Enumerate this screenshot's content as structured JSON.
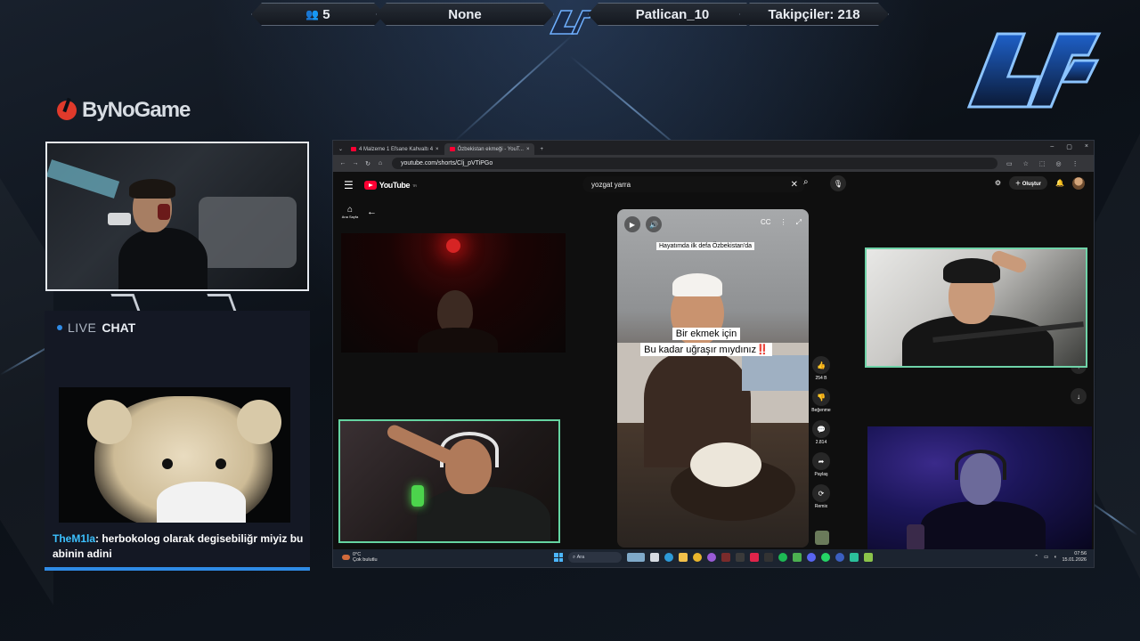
{
  "hud": {
    "viewers": "5",
    "game": "None",
    "last_follower": "Patlican_10",
    "followers": "Takipçiler: 218"
  },
  "brand": {
    "sponsor": "ByNoGame"
  },
  "chat": {
    "live_label": "LIVE",
    "chat_label": "CHAT",
    "message_user": "TheM1la",
    "message_text": ": herbokolog olarak degisebiliğr miyiz bu abinin adini"
  },
  "browser": {
    "tabs": [
      {
        "label": "4 Malzeme 1 Efsane Kahvaltı 4",
        "close": "×"
      },
      {
        "label": "Özbekistan ekmeği - YouT...",
        "close": "×"
      }
    ],
    "new_tab": "+",
    "url": "youtube.com/shorts/Clj_pVTiPGo",
    "window_controls": [
      "–",
      "▢",
      "×"
    ]
  },
  "youtube": {
    "logo_text": "YouTube",
    "logo_sup": "TR",
    "search_value": "yozgat yarra",
    "create_label": "Oluştur",
    "home_label": "Ana Sayfa",
    "short": {
      "caption_top": "Hayatımda ilk defa Özbekistan'da",
      "caption_line1": "Bir ekmek için",
      "caption_line2": "Bu kadar uğraşır mıydınız‼️"
    },
    "actions": [
      {
        "icon": "like-icon",
        "glyph": "👍",
        "label": "254 B"
      },
      {
        "icon": "dislike-icon",
        "glyph": "👎",
        "label": "Beğenme"
      },
      {
        "icon": "comment-icon",
        "glyph": "💬",
        "label": "2.814"
      },
      {
        "icon": "share-icon",
        "glyph": "➦",
        "label": "Paylaş"
      },
      {
        "icon": "remix-icon",
        "glyph": "⟳",
        "label": "Remix"
      }
    ]
  },
  "taskbar": {
    "temp": "0°C",
    "weather": "Çok bulutlu",
    "search_placeholder": "Ara",
    "time": "07:56",
    "date": "15.01.2026"
  },
  "colors": {
    "accent_blue": "#2f8be6",
    "chat_user": "#3cc1ff",
    "cam_border_green": "#65d4a1",
    "yt_red": "#ff0033"
  }
}
